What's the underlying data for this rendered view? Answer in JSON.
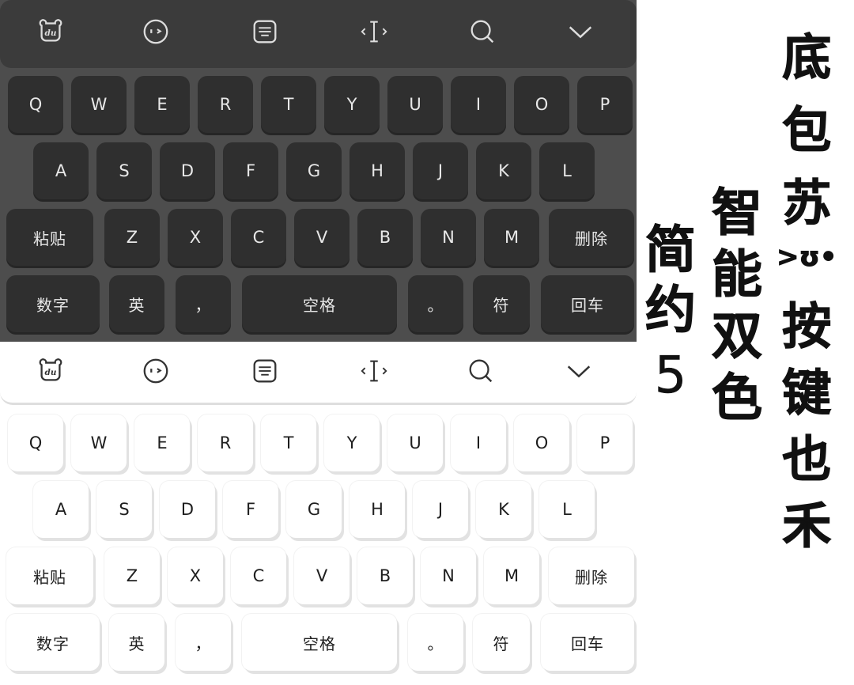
{
  "toolbar_icons": [
    "du-bear-logo-icon",
    "emoji-face-icon",
    "keyboard-layout-icon",
    "cursor-move-icon",
    "search-icon",
    "collapse-chevron-icon"
  ],
  "keyboard": {
    "row1": [
      "Q",
      "W",
      "E",
      "R",
      "T",
      "Y",
      "U",
      "I",
      "O",
      "P"
    ],
    "row2": [
      "A",
      "S",
      "D",
      "F",
      "G",
      "H",
      "J",
      "K",
      "L"
    ],
    "row3": {
      "paste": "粘贴",
      "letters": [
        "Z",
        "X",
        "C",
        "V",
        "B",
        "N",
        "M"
      ],
      "delete": "删除"
    },
    "row4": {
      "numbers": "数字",
      "lang": "英",
      "comma": "，",
      "space": "空格",
      "period": "。",
      "symbols": "符",
      "enter": "回车"
    }
  },
  "colors": {
    "dark_bg": "#4d4d4d",
    "dark_key": "#2f2f2f",
    "light_bg": "#ffffff",
    "light_key": "#ffffff"
  },
  "captions": {
    "col1": [
      "简",
      "约",
      "5"
    ],
    "col2": [
      "智",
      "能",
      "双",
      "色"
    ],
    "col3": [
      "底",
      "包",
      "苏",
      ">ʊ•",
      "按",
      "键",
      "也",
      "禾"
    ]
  }
}
